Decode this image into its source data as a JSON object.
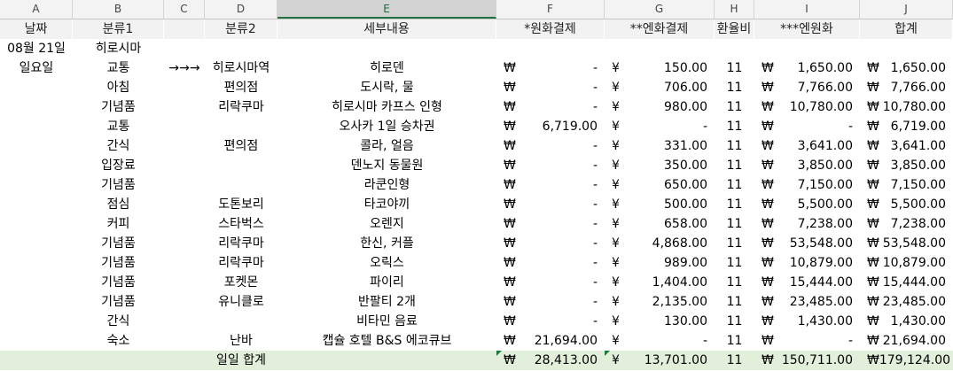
{
  "columns": [
    "A",
    "B",
    "C",
    "D",
    "E",
    "F",
    "G",
    "H",
    "I",
    "J"
  ],
  "headers": {
    "date": "날짜",
    "cat1": "분류1",
    "cat2": "분류2",
    "detail": "세부내용",
    "krw_pay": "*원화결제",
    "jpy_pay": "**엔화결제",
    "rate": "환율비",
    "jpy_krw": "***엔원화",
    "sum": "합계"
  },
  "symbols": {
    "won": "₩",
    "yen": "¥"
  },
  "day": {
    "date": "08월 21일",
    "weekday": "일요일",
    "place": "히로시마"
  },
  "rows": [
    {
      "cat1": "교통",
      "c": "→→→",
      "cat2": "히로시마역",
      "detail": "히로덴",
      "krw": "-",
      "jpy": "150.00",
      "rate": "11",
      "jk": "1,650.00",
      "sum": "1,650.00"
    },
    {
      "cat1": "아침",
      "c": "",
      "cat2": "편의점",
      "detail": "도시락, 물",
      "krw": "-",
      "jpy": "706.00",
      "rate": "11",
      "jk": "7,766.00",
      "sum": "7,766.00"
    },
    {
      "cat1": "기념품",
      "c": "",
      "cat2": "리락쿠마",
      "detail": "히로시마 카프스 인형",
      "krw": "-",
      "jpy": "980.00",
      "rate": "11",
      "jk": "10,780.00",
      "sum": "10,780.00"
    },
    {
      "cat1": "교통",
      "c": "",
      "cat2": "",
      "detail": "오사카 1일 승차권",
      "krw": "6,719.00",
      "jpy": "-",
      "rate": "11",
      "jk": "-",
      "sum": "6,719.00"
    },
    {
      "cat1": "간식",
      "c": "",
      "cat2": "편의점",
      "detail": "콜라, 얼음",
      "krw": "-",
      "jpy": "331.00",
      "rate": "11",
      "jk": "3,641.00",
      "sum": "3,641.00"
    },
    {
      "cat1": "입장료",
      "c": "",
      "cat2": "",
      "detail": "덴노지 동물원",
      "krw": "-",
      "jpy": "350.00",
      "rate": "11",
      "jk": "3,850.00",
      "sum": "3,850.00"
    },
    {
      "cat1": "기념품",
      "c": "",
      "cat2": "",
      "detail": "라쿤인형",
      "krw": "-",
      "jpy": "650.00",
      "rate": "11",
      "jk": "7,150.00",
      "sum": "7,150.00"
    },
    {
      "cat1": "점심",
      "c": "",
      "cat2": "도톤보리",
      "detail": "타코야끼",
      "krw": "-",
      "jpy": "500.00",
      "rate": "11",
      "jk": "5,500.00",
      "sum": "5,500.00"
    },
    {
      "cat1": "커피",
      "c": "",
      "cat2": "스타벅스",
      "detail": "오렌지",
      "krw": "-",
      "jpy": "658.00",
      "rate": "11",
      "jk": "7,238.00",
      "sum": "7,238.00"
    },
    {
      "cat1": "기념품",
      "c": "",
      "cat2": "리락쿠마",
      "detail": "한신, 커플",
      "krw": "-",
      "jpy": "4,868.00",
      "rate": "11",
      "jk": "53,548.00",
      "sum": "53,548.00"
    },
    {
      "cat1": "기념품",
      "c": "",
      "cat2": "리락쿠마",
      "detail": "오릭스",
      "krw": "-",
      "jpy": "989.00",
      "rate": "11",
      "jk": "10,879.00",
      "sum": "10,879.00"
    },
    {
      "cat1": "기념품",
      "c": "",
      "cat2": "포켓몬",
      "detail": "파이리",
      "krw": "-",
      "jpy": "1,404.00",
      "rate": "11",
      "jk": "15,444.00",
      "sum": "15,444.00"
    },
    {
      "cat1": "기념품",
      "c": "",
      "cat2": "유니클로",
      "detail": "반팔티 2개",
      "krw": "-",
      "jpy": "2,135.00",
      "rate": "11",
      "jk": "23,485.00",
      "sum": "23,485.00"
    },
    {
      "cat1": "간식",
      "c": "",
      "cat2": "",
      "detail": "비타민 음료",
      "krw": "-",
      "jpy": "130.00",
      "rate": "11",
      "jk": "1,430.00",
      "sum": "1,430.00"
    },
    {
      "cat1": "숙소",
      "c": "",
      "cat2": "난바",
      "detail": "캡슐 호텔 B&S 에코큐브",
      "krw": "21,694.00",
      "jpy": "-",
      "rate": "11",
      "jk": "-",
      "sum": "21,694.00"
    }
  ],
  "total": {
    "label": "일일 합계",
    "krw": "28,413.00",
    "jpy": "13,701.00",
    "rate": "11",
    "jk": "150,711.00",
    "sum": "179,124.00"
  }
}
